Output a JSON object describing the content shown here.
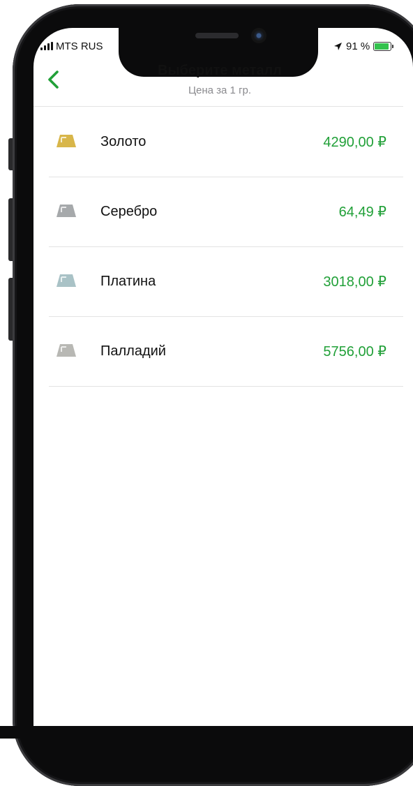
{
  "status_bar": {
    "carrier": "MTS RUS",
    "battery": "91 %"
  },
  "header": {
    "title": "Выберите металл",
    "subtitle": "Цена за 1 гр."
  },
  "metals": [
    {
      "name": "Золото",
      "price": "4290,00 ₽",
      "color": "#d8b64a"
    },
    {
      "name": "Серебро",
      "price": "64,49 ₽",
      "color": "#a6a9ab"
    },
    {
      "name": "Платина",
      "price": "3018,00 ₽",
      "color": "#a9c2c6"
    },
    {
      "name": "Палладий",
      "price": "5756,00 ₽",
      "color": "#b8b8b4"
    }
  ],
  "colors": {
    "accent": "#21a038",
    "battery": "#33c24d"
  },
  "icons": {
    "back": "chevron-left-icon",
    "location": "location-arrow-icon",
    "metal": "metal-bar-icon"
  }
}
